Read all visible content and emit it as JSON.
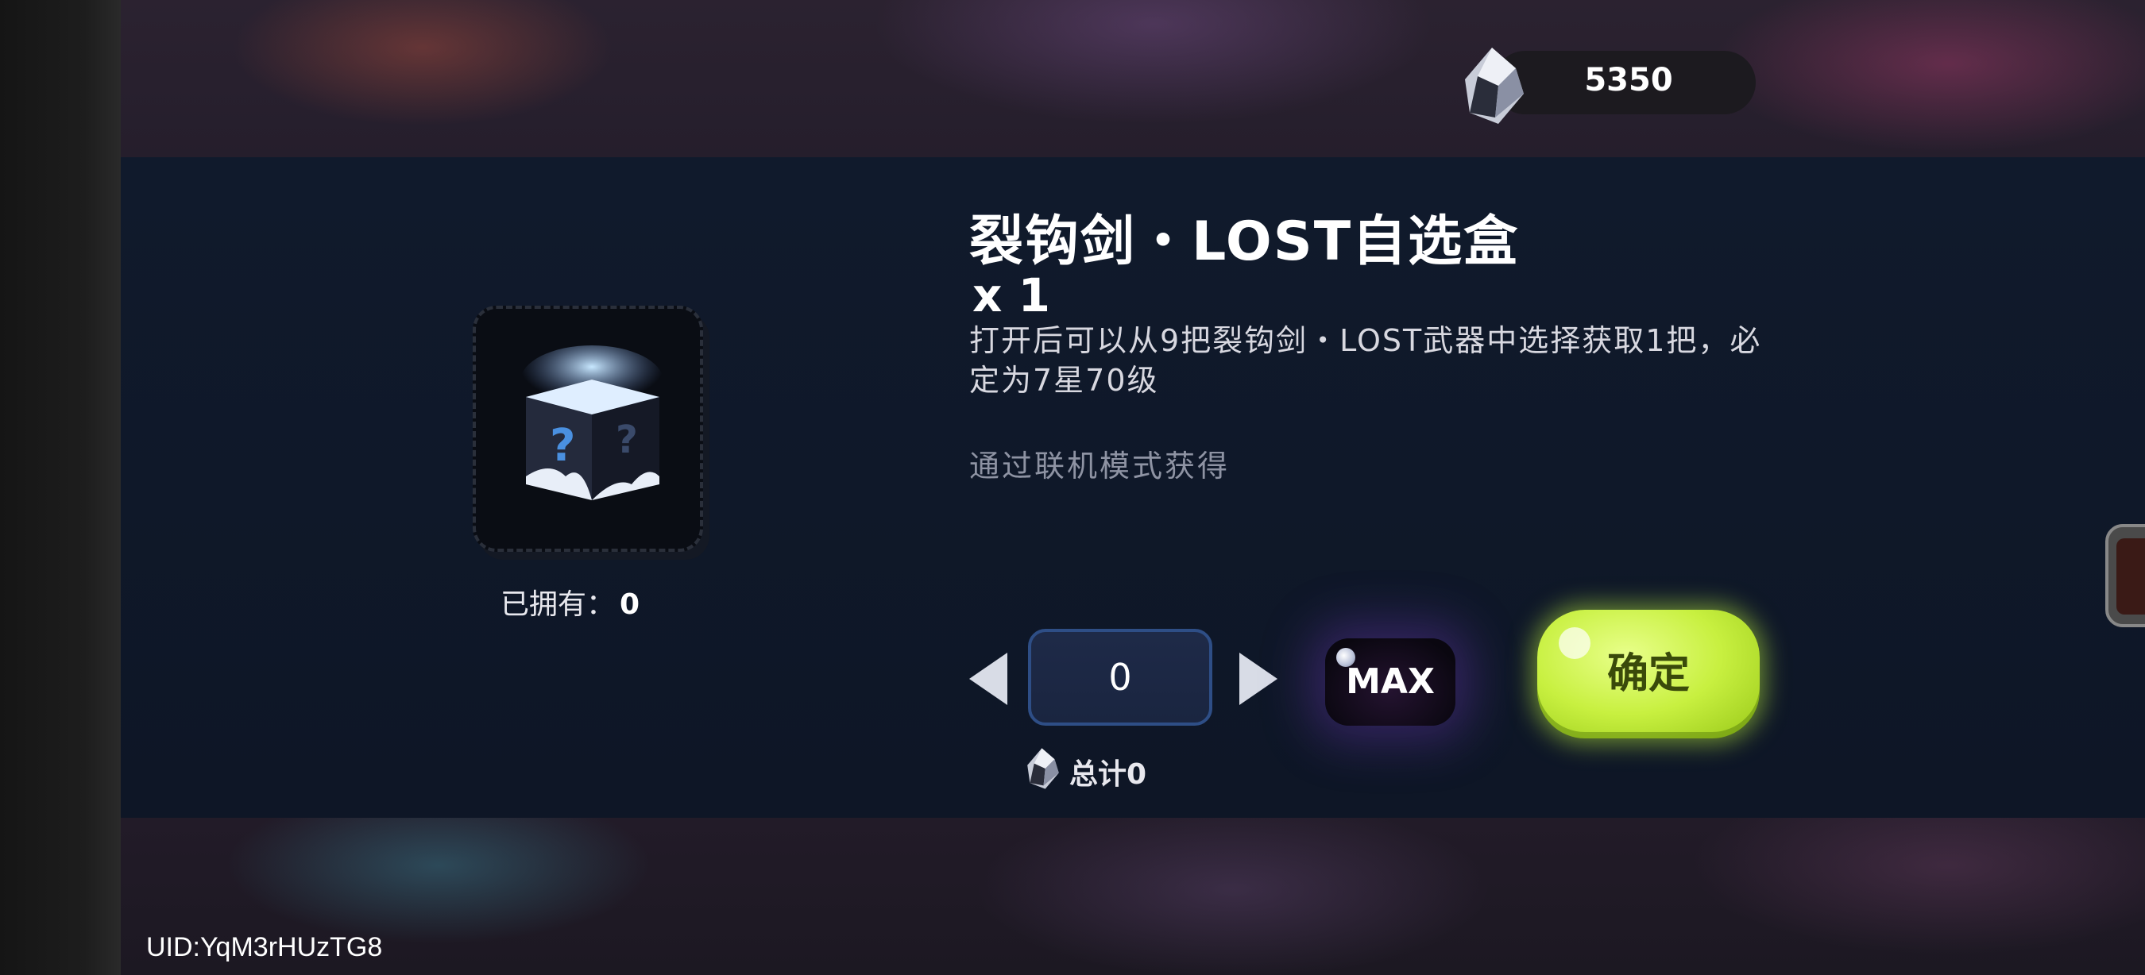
{
  "currency": {
    "icon": "crystal-gem-icon",
    "amount": "5350"
  },
  "item": {
    "icon": "mystery-box-icon",
    "name": "裂钩剑・LOST自选盒",
    "quantity": "x 1",
    "description": "打开后可以从9把裂钩剑・LOST武器中选择获取1把，必定为7星70级",
    "source": "通过联机模式获得",
    "owned_label": "已拥有：",
    "owned_count": "0"
  },
  "purchase": {
    "quantity_value": "0",
    "max_label": "MAX",
    "confirm_label": "确定",
    "total_label": "总计0",
    "total_icon": "crystal-gem-icon"
  },
  "footer": {
    "uid": "UID:YqM3rHUzTG8"
  },
  "colors": {
    "panel": "#101a2c",
    "confirm": "#c8f040",
    "qty_border": "#2e4e86"
  }
}
